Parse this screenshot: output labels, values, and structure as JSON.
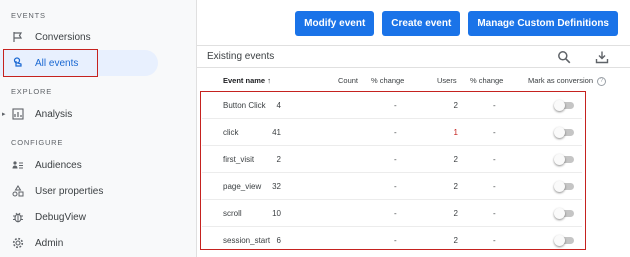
{
  "sidebar": {
    "sections": {
      "events": "EVENTS",
      "explore": "EXPLORE",
      "configure": "CONFIGURE"
    },
    "items": [
      {
        "label": "Conversions",
        "icon": "flag-icon"
      },
      {
        "label": "All events",
        "icon": "touch-icon",
        "active": true
      },
      {
        "label": "Analysis",
        "icon": "analysis-icon"
      },
      {
        "label": "Audiences",
        "icon": "audience-icon"
      },
      {
        "label": "User properties",
        "icon": "user-properties-icon"
      },
      {
        "label": "DebugView",
        "icon": "bug-icon"
      },
      {
        "label": "Admin",
        "icon": "gear-icon"
      }
    ],
    "caret": "▸"
  },
  "toolbar": {
    "modify_label": "Modify event",
    "create_label": "Create event",
    "manage_label": "Manage Custom Definitions"
  },
  "card": {
    "title": "Existing events",
    "icons": [
      "search-icon",
      "download-icon"
    ]
  },
  "table": {
    "headers": {
      "name": "Event name",
      "sort_arrow": "↑",
      "count": "Count",
      "count_change": "% change",
      "users": "Users",
      "users_change": "% change",
      "conversion": "Mark as conversion",
      "help": "?"
    },
    "rows": [
      {
        "name": "Button Click",
        "count": "4",
        "count_change": "-",
        "users": "2",
        "users_change": "-",
        "conversion": false
      },
      {
        "name": "click",
        "count": "41",
        "count_change": "-",
        "users": "1",
        "users_change": "-",
        "conversion": false
      },
      {
        "name": "first_visit",
        "count": "2",
        "count_change": "-",
        "users": "2",
        "users_change": "-",
        "conversion": false
      },
      {
        "name": "page_view",
        "count": "32",
        "count_change": "-",
        "users": "2",
        "users_change": "-",
        "conversion": false
      },
      {
        "name": "scroll",
        "count": "10",
        "count_change": "-",
        "users": "2",
        "users_change": "-",
        "conversion": false
      },
      {
        "name": "session_start",
        "count": "6",
        "count_change": "-",
        "users": "2",
        "users_change": "-",
        "conversion": false
      }
    ]
  },
  "colors": {
    "accent": "#1a73e8",
    "active_bg": "#e8f0fe",
    "highlight": "#c5221f"
  }
}
